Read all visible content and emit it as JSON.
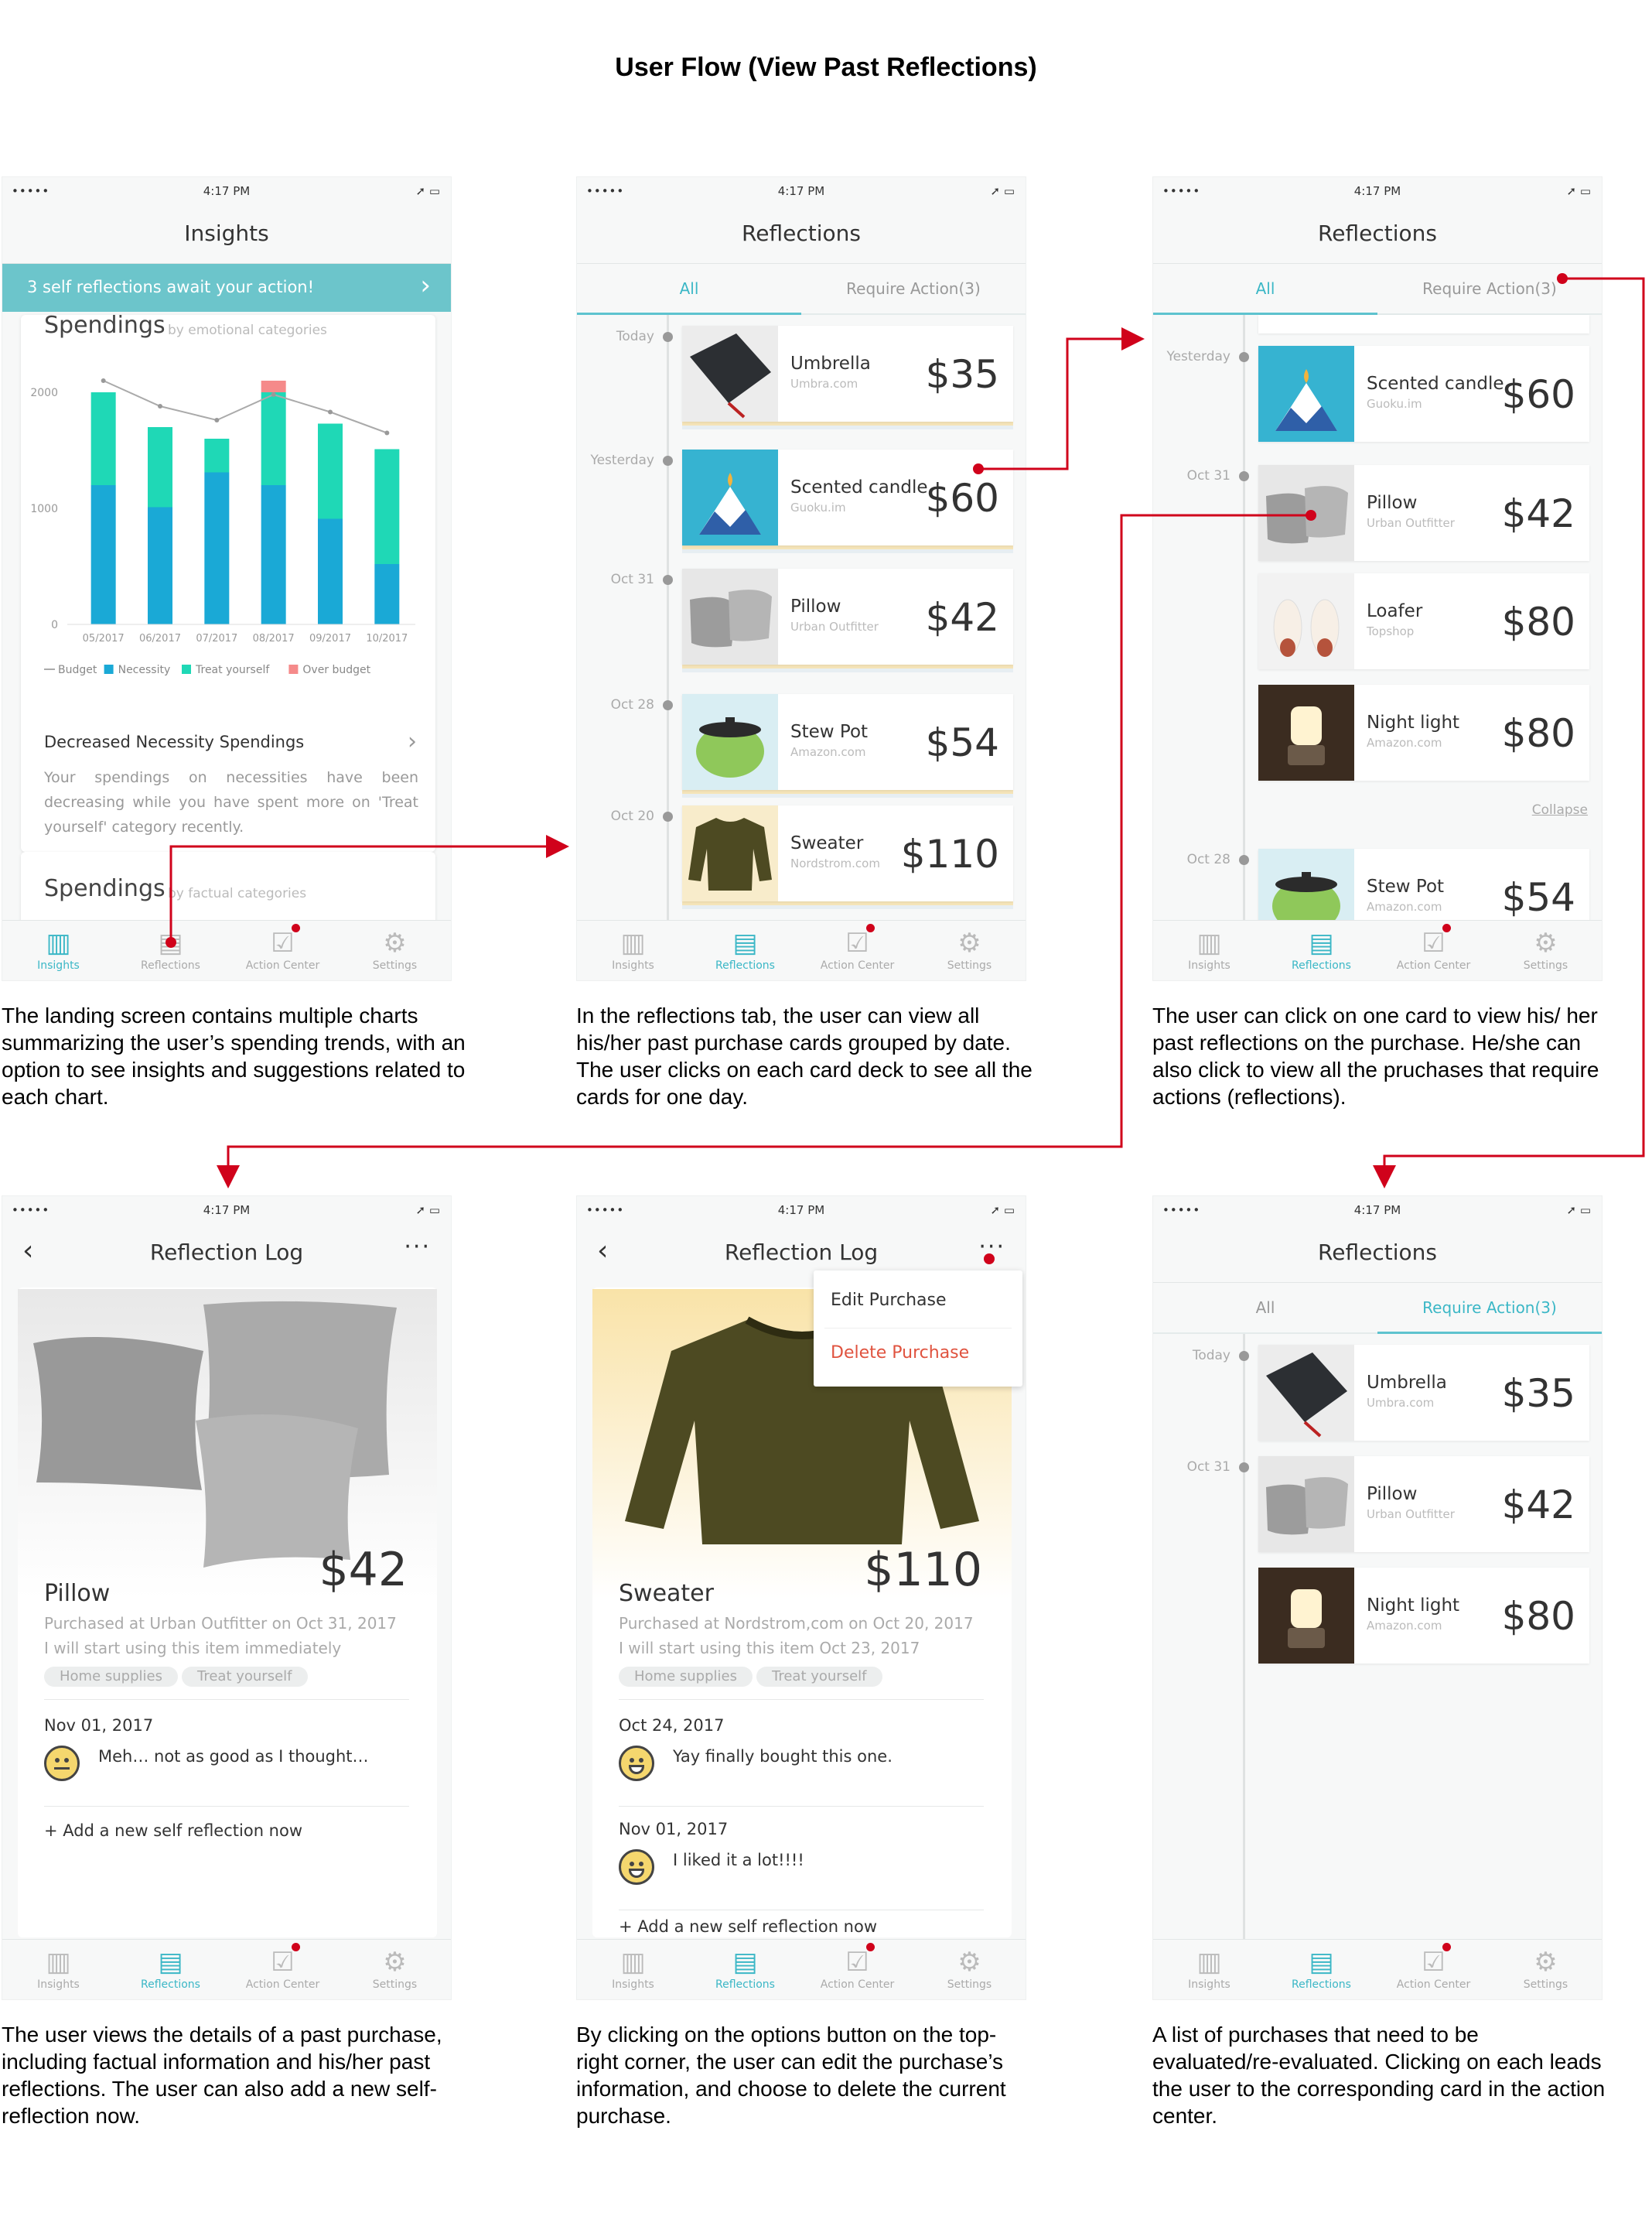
{
  "page_title": "User Flow (View Past Reflections)",
  "status": {
    "signal": "•••••",
    "wifi": "ᯤ",
    "time": "4:17 PM",
    "battery": "➚ ▭"
  },
  "tabs": [
    "Insights",
    "Reflections",
    "Action Center",
    "Settings"
  ],
  "icons": {
    "insights": "bar-chart-icon",
    "reflections": "document-icon",
    "action": "checkbox-icon",
    "settings": "gear-icon",
    "back": "chevron-left-icon",
    "more": "more-dots-icon"
  },
  "colors": {
    "accent": "#3bb7c6",
    "necessity": "#1aa9d6",
    "treat": "#1fd8b6",
    "over": "#f58a8a",
    "flow": "#d0021b"
  },
  "screen1": {
    "title": "Insights",
    "banner": "3 self reflections await your action!",
    "section1_title": "Spendings",
    "section1_sub": "by emotional categories",
    "insight_title": "Decreased Necessity Spendings",
    "insight_text": "Your spendings on necessities have been decreasing while you have spent more on 'Treat yourself' category recently.",
    "section2_title": "Spendings",
    "section2_sub": "by factual categories",
    "caption": "The landing screen contains multiple charts summarizing the user’s spending trends, with an option to see insights and suggestions related to each chart."
  },
  "chart_data": {
    "type": "bar",
    "categories": [
      "05/2017",
      "06/2017",
      "07/2017",
      "08/2017",
      "09/2017",
      "10/2017"
    ],
    "series": [
      {
        "name": "Necessity",
        "values": [
          1200,
          1010,
          1310,
          1200,
          910,
          520
        ]
      },
      {
        "name": "Treat yourself",
        "values": [
          800,
          690,
          290,
          800,
          820,
          990
        ]
      },
      {
        "name": "Over budget",
        "values": [
          0,
          0,
          0,
          100,
          0,
          0
        ]
      },
      {
        "name": "Budget",
        "values": [
          2100,
          1880,
          1760,
          1980,
          1830,
          1650
        ]
      }
    ],
    "yticks": [
      "0",
      "1000",
      "2000"
    ],
    "ylim": [
      0,
      2200
    ],
    "legend": [
      "Budget",
      "Necessity",
      "Treat yourself",
      "Over budget"
    ],
    "stacked": true
  },
  "screen2": {
    "title": "Reflections",
    "seg_all": "All",
    "seg_req": "Require Action(3)",
    "groups": [
      {
        "date": "Today",
        "name": "Umbrella",
        "store": "Umbra.com",
        "price": "$35"
      },
      {
        "date": "Yesterday",
        "name": "Scented candle",
        "store": "Guoku.im",
        "price": "$60"
      },
      {
        "date": "Oct 31",
        "name": "Pillow",
        "store": "Urban Outfitter",
        "price": "$42"
      },
      {
        "date": "Oct 28",
        "name": "Stew Pot",
        "store": "Amazon.com",
        "price": "$54"
      },
      {
        "date": "Oct 20",
        "name": "Sweater",
        "store": "Nordstrom.com",
        "price": "$110"
      }
    ],
    "caption": "In the reflections tab, the user can view all his/her past purchase cards grouped by date. The user clicks on each card deck to see all the cards for one day."
  },
  "screen3": {
    "title": "Reflections",
    "seg_all": "All",
    "seg_req": "Require Action(3)",
    "groups": [
      {
        "date": "Yesterday",
        "name": "Scented candle",
        "store": "Guoku.im",
        "price": "$60"
      },
      {
        "date": "Oct 31",
        "name": "Pillow",
        "store": "Urban Outfitter",
        "price": "$42"
      },
      {
        "date": "",
        "name": "Loafer",
        "store": "Topshop",
        "price": "$80"
      },
      {
        "date": "",
        "name": "Night light",
        "store": "Amazon.com",
        "price": "$80"
      },
      {
        "date": "Oct 28",
        "name": "Stew Pot",
        "store": "Amazon.com",
        "price": "$54"
      }
    ],
    "collapse": "Collapse",
    "caption": "The user can click on one card to view his/ her past reflections on the purchase. He/she can also click to view all the pruchases that require actions (reflections)."
  },
  "screen4": {
    "title": "Reflection Log",
    "more": "···",
    "price": "$42",
    "name": "Pillow",
    "purchased": "Purchased at Urban Outfitter on Oct 31, 2017",
    "intent": "I will start using this item immediately",
    "chips": [
      "Home supplies",
      "Treat yourself"
    ],
    "reflections": [
      {
        "date": "Nov 01, 2017",
        "text": "Meh… not as good as I thought…"
      }
    ],
    "add": "+ Add a new self reflection now",
    "caption": "The user views the details of a past purchase, including factual information and his/her past reflections. The user can also add a new self-reflection now."
  },
  "screen5": {
    "title": "Reflection Log",
    "more": "···",
    "menu": [
      "Edit Purchase",
      "Delete Purchase"
    ],
    "price": "$110",
    "name": "Sweater",
    "purchased": "Purchased at Nordstrom,com on Oct 20, 2017",
    "intent": "I will start using this item Oct 23, 2017",
    "chips": [
      "Home supplies",
      "Treat yourself"
    ],
    "reflections": [
      {
        "date": "Oct 24, 2017",
        "text": "Yay finally bought this one."
      },
      {
        "date": "Nov 01, 2017",
        "text": "I liked it a lot!!!!"
      }
    ],
    "add": "+ Add a new self reflection now",
    "caption": "By clicking on the options button on the top-right corner, the user can edit the purchase’s information, and choose to delete the current purchase."
  },
  "screen6": {
    "title": "Reflections",
    "seg_all": "All",
    "seg_req": "Require Action(3)",
    "groups": [
      {
        "date": "Today",
        "name": "Umbrella",
        "store": "Umbra.com",
        "price": "$35"
      },
      {
        "date": "Oct 31",
        "name": "Pillow",
        "store": "Urban Outfitter",
        "price": "$42"
      },
      {
        "date": "",
        "name": "Night light",
        "store": "Amazon.com",
        "price": "$80"
      }
    ],
    "caption": "A list of purchases that need to be evaluated/re-evaluated. Clicking on each leads the user to the corresponding card in the action center."
  }
}
